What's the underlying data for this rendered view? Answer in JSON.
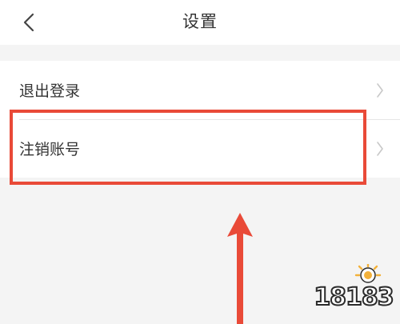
{
  "header": {
    "title": "设置",
    "back_icon": "chevron-left-icon"
  },
  "list": {
    "items": [
      {
        "label": "退出登录",
        "icon": "chevron-right-icon"
      },
      {
        "label": "注销账号",
        "icon": "chevron-right-icon"
      }
    ]
  },
  "annotation": {
    "highlight_color": "#e94a38",
    "arrow_color": "#e94a38"
  },
  "watermark": {
    "text": "18183"
  }
}
